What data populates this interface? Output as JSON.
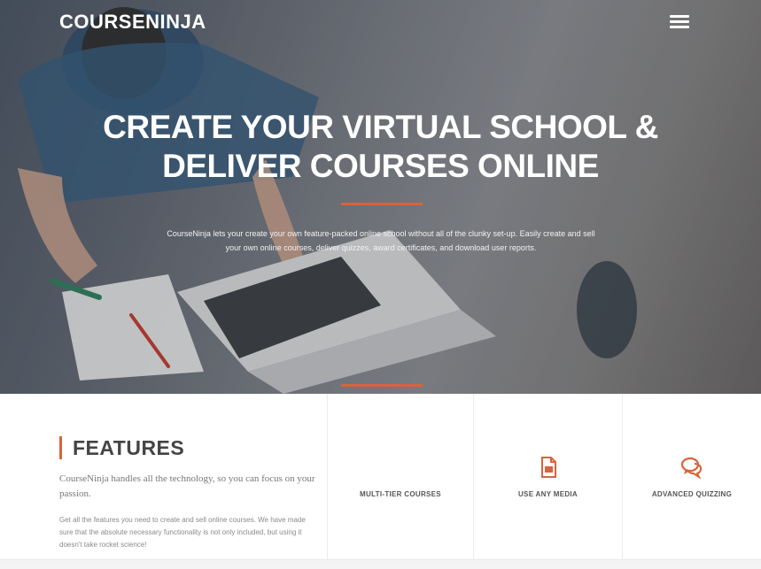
{
  "header": {
    "logo": "COURSENINJA",
    "menu_icon": "hamburger-menu-icon"
  },
  "hero": {
    "title_line1": "CREATE YOUR VIRTUAL SCHOOL &",
    "title_line2": "DELIVER COURSES ONLINE",
    "description": "CourseNinja lets your create your own feature-packed online school without all of the clunky set-up. Easily create and sell your own online courses, deliver quizzes, award certificates, and download user reports.",
    "accent_color": "#d9633a"
  },
  "features": {
    "heading": "FEATURES",
    "lead": "CourseNinja handles all the technology, so you can focus on your passion.",
    "body": "Get all the features you need to create and sell online courses. We have made sure that the absolute necessary functionality is not only included, but using it doesn't take rocket science!",
    "items": [
      {
        "label": "MULTI-TIER COURSES",
        "icon": ""
      },
      {
        "label": "USE ANY MEDIA",
        "icon": "media-file-icon"
      },
      {
        "label": "ADVANCED QUIZZING",
        "icon": "chat-bubbles-icon"
      }
    ]
  }
}
